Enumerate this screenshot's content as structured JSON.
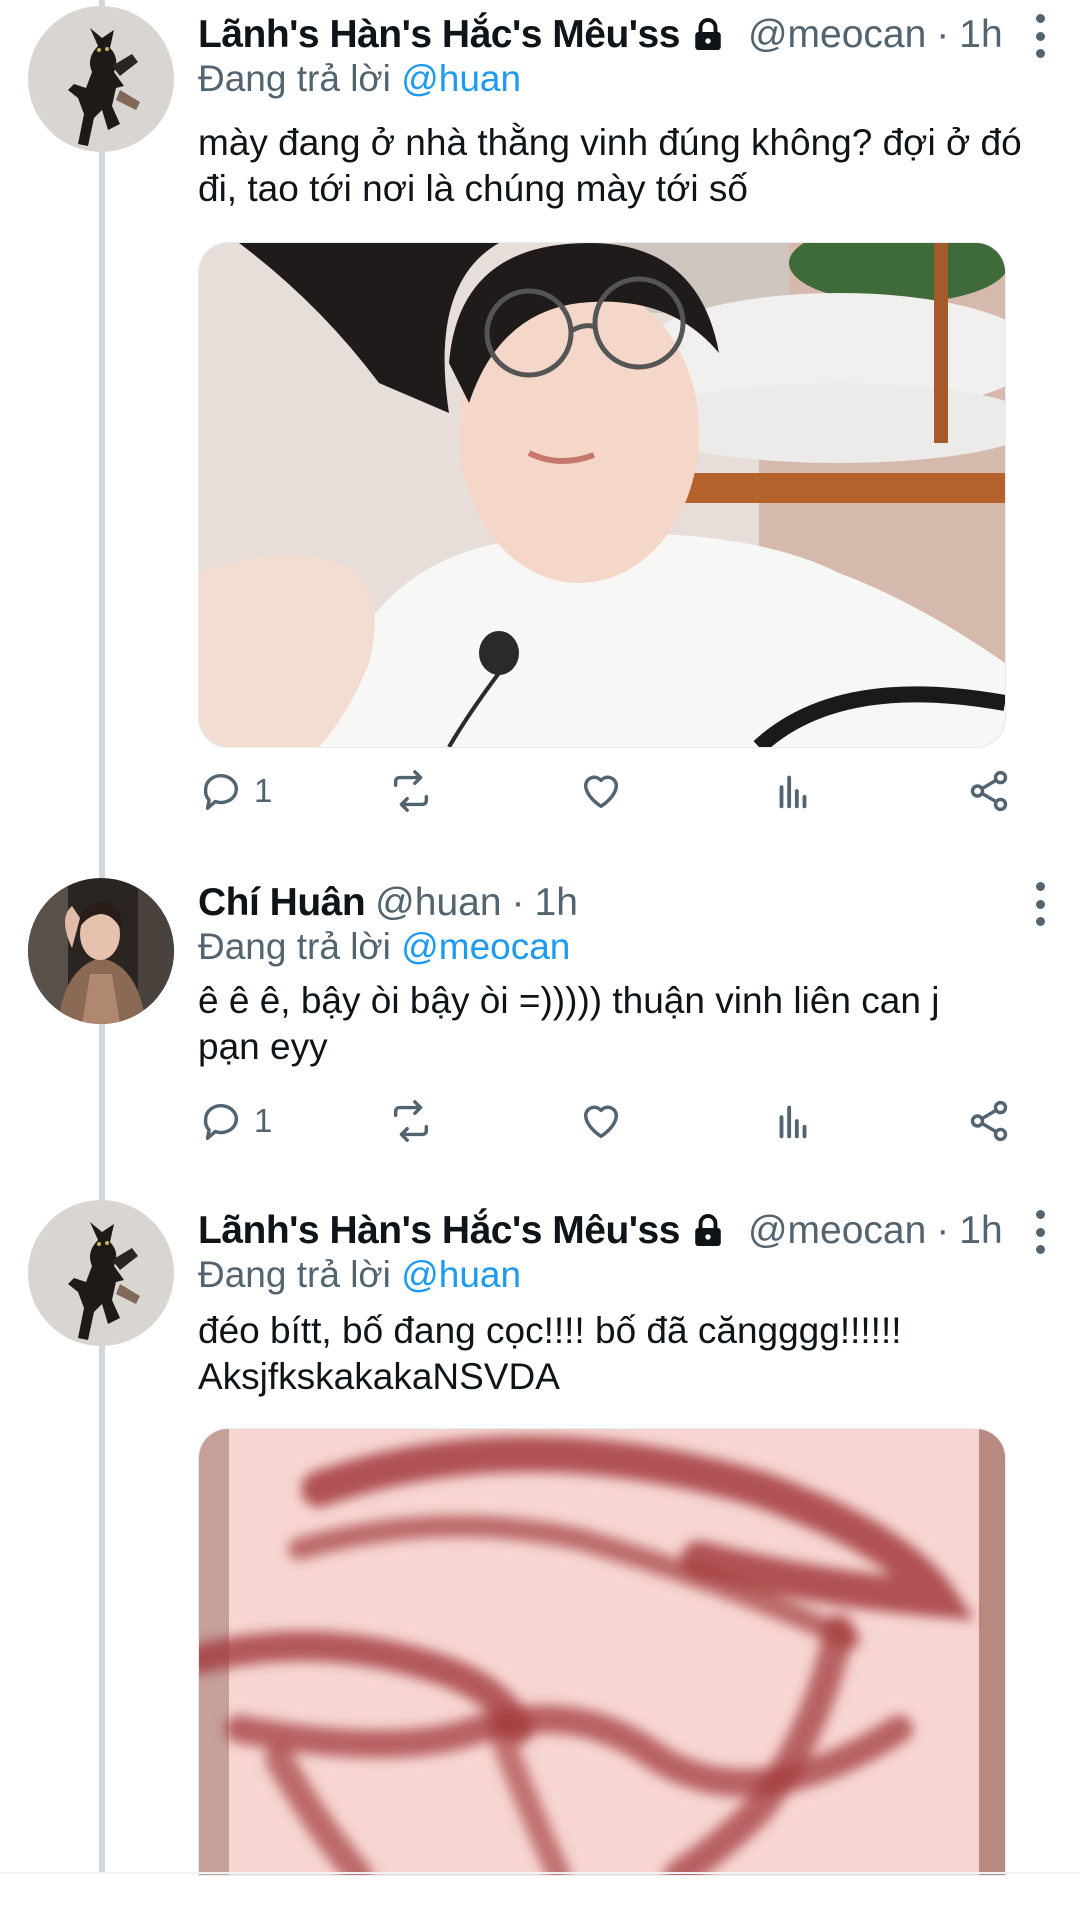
{
  "colors": {
    "link": "#1d9bf0",
    "muted": "#536471",
    "text": "#0f1419",
    "thread_line": "#cfd9de"
  },
  "tweets": [
    {
      "display_name": "Lãnh's Hàn's Hắc's Mêu'ss",
      "locked": true,
      "handle": "@meocan",
      "separator": "·",
      "time": "1h",
      "reply_prefix": "Đang trả lời",
      "reply_to": "@huan",
      "text": "mày đang ở nhà thằng vinh đúng không? đợi ở đó đi, tao tới nơi là chúng mày tới số",
      "media": "photo of person with round glasses in white sweater",
      "reply_count": "1",
      "icons": [
        "reply-icon",
        "retweet-icon",
        "like-icon",
        "analytics-icon",
        "share-icon"
      ]
    },
    {
      "display_name": "Chí Huân",
      "locked": false,
      "handle": "@huan",
      "separator": "·",
      "time": "1h",
      "reply_prefix": "Đang trả lời",
      "reply_to": "@meocan",
      "text": "ê ê ê, bậy òi bậy òi =))))) thuận vinh liên can j pạn eyy",
      "reply_count": "1",
      "icons": [
        "reply-icon",
        "retweet-icon",
        "like-icon",
        "analytics-icon",
        "share-icon"
      ]
    },
    {
      "display_name": "Lãnh's Hàn's Hắc's Mêu'ss",
      "locked": true,
      "handle": "@meocan",
      "separator": "·",
      "time": "1h",
      "reply_prefix": "Đang trả lời",
      "reply_to": "@huan",
      "text": "đéo bítt, bố đang cọc!!!! bố đã căngggg!!!!!! AksjfkskakakaNSVDA",
      "media": "blurred pink and dark red motion image"
    }
  ]
}
